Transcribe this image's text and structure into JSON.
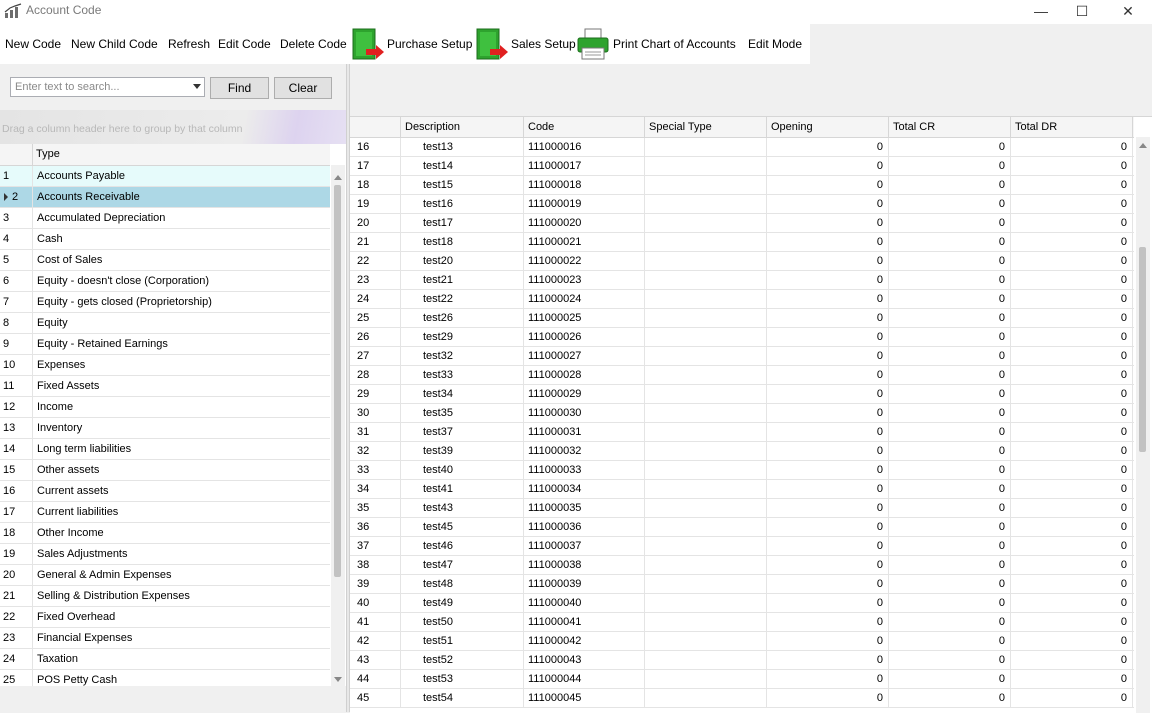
{
  "window": {
    "title": "Account Code",
    "minimize_glyph": "—",
    "maximize_glyph": "☐",
    "close_glyph": "✕"
  },
  "toolbar": {
    "new_code": "New Code",
    "new_child_code": "New Child Code",
    "refresh": "Refresh",
    "edit_code": "Edit Code",
    "delete_code": "Delete Code",
    "purchase_setup": "Purchase Setup",
    "sales_setup": "Sales Setup",
    "print_chart": "Print Chart of Accounts",
    "edit_mode": "Edit Mode",
    "icons": {
      "purchase": "door-arrow-icon",
      "sales": "door-arrow-icon",
      "print": "printer-icon"
    }
  },
  "search": {
    "placeholder": "Enter text to search...",
    "find": "Find",
    "clear": "Clear"
  },
  "group_panel": {
    "hint": "Drag a column header here to group by that column"
  },
  "type_grid": {
    "header": "Type",
    "selected_index": 1,
    "focused_index": 0,
    "rows": [
      {
        "num": "1",
        "type": "Accounts Payable"
      },
      {
        "num": "2",
        "type": "Accounts Receivable"
      },
      {
        "num": "3",
        "type": "Accumulated Depreciation"
      },
      {
        "num": "4",
        "type": "Cash"
      },
      {
        "num": "5",
        "type": "Cost of Sales"
      },
      {
        "num": "6",
        "type": "Equity - doesn't close (Corporation)"
      },
      {
        "num": "7",
        "type": "Equity - gets closed (Proprietorship)"
      },
      {
        "num": "8",
        "type": "Equity"
      },
      {
        "num": "9",
        "type": "Equity - Retained Earnings"
      },
      {
        "num": "10",
        "type": "Expenses"
      },
      {
        "num": "11",
        "type": "Fixed Assets"
      },
      {
        "num": "12",
        "type": "Income"
      },
      {
        "num": "13",
        "type": "Inventory"
      },
      {
        "num": "14",
        "type": "Long term liabilities"
      },
      {
        "num": "15",
        "type": "Other assets"
      },
      {
        "num": "16",
        "type": "Current assets"
      },
      {
        "num": "17",
        "type": "Current liabilities"
      },
      {
        "num": "18",
        "type": "Other Income"
      },
      {
        "num": "19",
        "type": "Sales Adjustments"
      },
      {
        "num": "20",
        "type": "General & Admin Expenses"
      },
      {
        "num": "21",
        "type": "Selling & Distribution Expenses"
      },
      {
        "num": "22",
        "type": "Fixed Overhead"
      },
      {
        "num": "23",
        "type": "Financial Expenses"
      },
      {
        "num": "24",
        "type": "Taxation"
      },
      {
        "num": "25",
        "type": "POS Petty Cash"
      }
    ]
  },
  "code_grid": {
    "headers": [
      "Description",
      "Code",
      "Special Type",
      "Opening",
      "Total CR",
      "Total DR"
    ],
    "rows": [
      {
        "num": "16",
        "desc": "test13",
        "code": "111000016",
        "special": "",
        "opening": "0",
        "cr": "0",
        "dr": "0"
      },
      {
        "num": "17",
        "desc": "test14",
        "code": "111000017",
        "special": "",
        "opening": "0",
        "cr": "0",
        "dr": "0"
      },
      {
        "num": "18",
        "desc": "test15",
        "code": "111000018",
        "special": "",
        "opening": "0",
        "cr": "0",
        "dr": "0"
      },
      {
        "num": "19",
        "desc": "test16",
        "code": "111000019",
        "special": "",
        "opening": "0",
        "cr": "0",
        "dr": "0"
      },
      {
        "num": "20",
        "desc": "test17",
        "code": "111000020",
        "special": "",
        "opening": "0",
        "cr": "0",
        "dr": "0"
      },
      {
        "num": "21",
        "desc": "test18",
        "code": "111000021",
        "special": "",
        "opening": "0",
        "cr": "0",
        "dr": "0"
      },
      {
        "num": "22",
        "desc": "test20",
        "code": "111000022",
        "special": "",
        "opening": "0",
        "cr": "0",
        "dr": "0"
      },
      {
        "num": "23",
        "desc": "test21",
        "code": "111000023",
        "special": "",
        "opening": "0",
        "cr": "0",
        "dr": "0"
      },
      {
        "num": "24",
        "desc": "test22",
        "code": "111000024",
        "special": "",
        "opening": "0",
        "cr": "0",
        "dr": "0"
      },
      {
        "num": "25",
        "desc": "test26",
        "code": "111000025",
        "special": "",
        "opening": "0",
        "cr": "0",
        "dr": "0"
      },
      {
        "num": "26",
        "desc": "test29",
        "code": "111000026",
        "special": "",
        "opening": "0",
        "cr": "0",
        "dr": "0"
      },
      {
        "num": "27",
        "desc": "test32",
        "code": "111000027",
        "special": "",
        "opening": "0",
        "cr": "0",
        "dr": "0"
      },
      {
        "num": "28",
        "desc": "test33",
        "code": "111000028",
        "special": "",
        "opening": "0",
        "cr": "0",
        "dr": "0"
      },
      {
        "num": "29",
        "desc": "test34",
        "code": "111000029",
        "special": "",
        "opening": "0",
        "cr": "0",
        "dr": "0"
      },
      {
        "num": "30",
        "desc": "test35",
        "code": "111000030",
        "special": "",
        "opening": "0",
        "cr": "0",
        "dr": "0"
      },
      {
        "num": "31",
        "desc": "test37",
        "code": "111000031",
        "special": "",
        "opening": "0",
        "cr": "0",
        "dr": "0"
      },
      {
        "num": "32",
        "desc": "test39",
        "code": "111000032",
        "special": "",
        "opening": "0",
        "cr": "0",
        "dr": "0"
      },
      {
        "num": "33",
        "desc": "test40",
        "code": "111000033",
        "special": "",
        "opening": "0",
        "cr": "0",
        "dr": "0"
      },
      {
        "num": "34",
        "desc": "test41",
        "code": "111000034",
        "special": "",
        "opening": "0",
        "cr": "0",
        "dr": "0"
      },
      {
        "num": "35",
        "desc": "test43",
        "code": "111000035",
        "special": "",
        "opening": "0",
        "cr": "0",
        "dr": "0"
      },
      {
        "num": "36",
        "desc": "test45",
        "code": "111000036",
        "special": "",
        "opening": "0",
        "cr": "0",
        "dr": "0"
      },
      {
        "num": "37",
        "desc": "test46",
        "code": "111000037",
        "special": "",
        "opening": "0",
        "cr": "0",
        "dr": "0"
      },
      {
        "num": "38",
        "desc": "test47",
        "code": "111000038",
        "special": "",
        "opening": "0",
        "cr": "0",
        "dr": "0"
      },
      {
        "num": "39",
        "desc": "test48",
        "code": "111000039",
        "special": "",
        "opening": "0",
        "cr": "0",
        "dr": "0"
      },
      {
        "num": "40",
        "desc": "test49",
        "code": "111000040",
        "special": "",
        "opening": "0",
        "cr": "0",
        "dr": "0"
      },
      {
        "num": "41",
        "desc": "test50",
        "code": "111000041",
        "special": "",
        "opening": "0",
        "cr": "0",
        "dr": "0"
      },
      {
        "num": "42",
        "desc": "test51",
        "code": "111000042",
        "special": "",
        "opening": "0",
        "cr": "0",
        "dr": "0"
      },
      {
        "num": "43",
        "desc": "test52",
        "code": "111000043",
        "special": "",
        "opening": "0",
        "cr": "0",
        "dr": "0"
      },
      {
        "num": "44",
        "desc": "test53",
        "code": "111000044",
        "special": "",
        "opening": "0",
        "cr": "0",
        "dr": "0"
      },
      {
        "num": "45",
        "desc": "test54",
        "code": "111000045",
        "special": "",
        "opening": "0",
        "cr": "0",
        "dr": "0"
      }
    ]
  },
  "colors": {
    "selected_row": "#add8e6",
    "focused_row": "#e6fbfb",
    "door_green": "#2ea32e",
    "arrow_red": "#e02020"
  }
}
